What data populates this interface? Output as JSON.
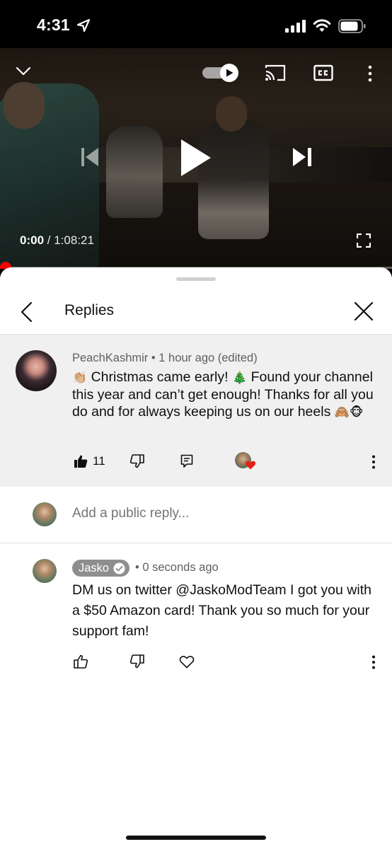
{
  "status_bar": {
    "time": "4:31",
    "icons": [
      "location-arrow-icon",
      "signal-icon",
      "wifi-icon",
      "battery-icon"
    ]
  },
  "player": {
    "current_time": "0:00",
    "separator": "/",
    "duration": "1:08:21",
    "progress_fraction": 0.0,
    "autoplay_on": true,
    "accent_color": "#ff0000",
    "icons": [
      "chevron-down-icon",
      "autoplay-toggle",
      "cast-icon",
      "closed-captions-icon",
      "more-vertical-icon",
      "previous-icon",
      "play-icon",
      "next-icon",
      "fullscreen-icon"
    ]
  },
  "sheet": {
    "title": "Replies",
    "icons": [
      "back-icon",
      "close-icon"
    ]
  },
  "parent_comment": {
    "author": "PeachKashmir",
    "meta": "• 1 hour ago (edited)",
    "text_line1_emoji": "👏🏼",
    "text_line1": " Christmas came early! ",
    "text_tree_emoji": "🎄",
    "text_line1_end": " Found your",
    "text_rest": "channel this year and can’t get enough! Thanks for all you do and for always keeping us on our heels ",
    "text_end_emoji": "🙈🐵",
    "like_count": "11",
    "hearted_by_creator": true,
    "heart_color": "#e62117"
  },
  "add_reply": {
    "placeholder": "Add a public reply..."
  },
  "reply": {
    "author": "Jasko",
    "verified": true,
    "meta": "• 0 seconds ago",
    "text": "DM us on twitter @JaskoModTeam I got you with a $50 Amazon card! Thank you so much for your support fam!"
  }
}
